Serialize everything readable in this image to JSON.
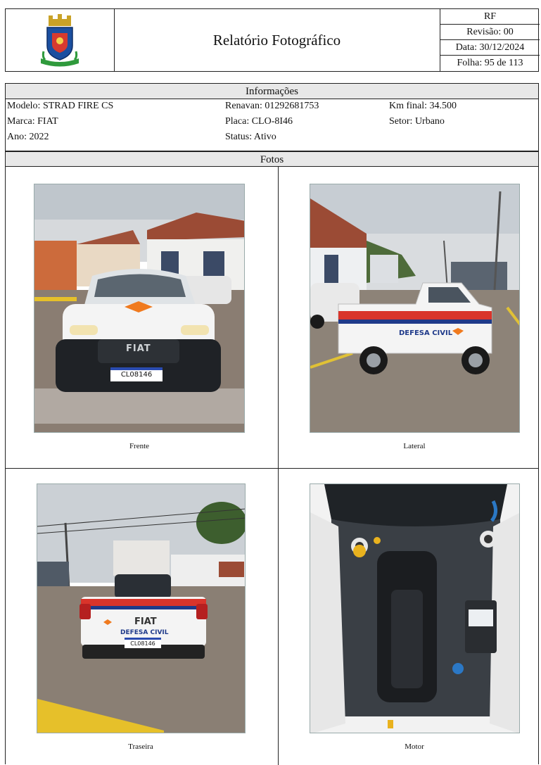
{
  "header": {
    "title": "Relatório Fotográfico",
    "code": "RF",
    "revision": "Revisão: 00",
    "date": "Data: 30/12/2024",
    "sheet": "Folha: 95 de 113"
  },
  "info": {
    "section_title": "Informações",
    "modelo": "Modelo: STRAD FIRE CS",
    "marca": "Marca: FIAT",
    "ano": "Ano: 2022",
    "renavan": "Renavan: 01292681753",
    "placa": "Placa: CLO-8I46",
    "status": "Status: Ativo",
    "km_final": "Km final: 34.500",
    "setor": "Setor: Urbano"
  },
  "photos": {
    "section_title": "Fotos",
    "items": [
      {
        "caption": "Frente"
      },
      {
        "caption": "Lateral"
      },
      {
        "caption": "Traseira"
      },
      {
        "caption": "Motor"
      }
    ],
    "plate_text": "CL08146",
    "brand_text": "FIAT",
    "defesa_text": "DEFESA CIVIL"
  },
  "colors": {
    "header_bar": "#e8e8e8",
    "border": "#222222",
    "car_body": "#f4f4f4",
    "defesa_blue": "#1f3a8a",
    "defesa_orange": "#f07a1e",
    "defesa_red": "#d9342b"
  }
}
